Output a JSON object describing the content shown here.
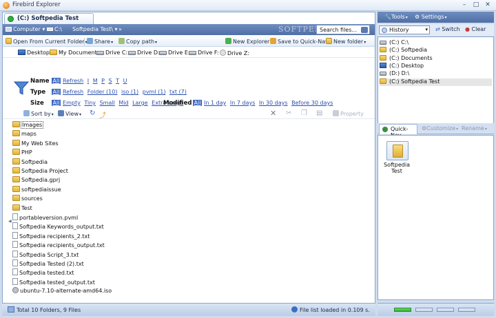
{
  "window": {
    "title": "Firebird Explorer"
  },
  "tab": {
    "label": "(C:) Softpedia Test"
  },
  "address": {
    "crumbs": [
      "Computer ▾",
      "C:\\",
      "Softpedia Test\\ ▾",
      "»"
    ],
    "watermark": "SOFTPEDIA",
    "search_placeholder": "Search files..."
  },
  "toolbar": {
    "open_from": "Open From Current Folder",
    "share": "Share",
    "copy_path": "Copy path",
    "new_explorer": "New Explorer",
    "save_quicknav": "Save to Quick-Nav",
    "new_folder": "New folder"
  },
  "places": [
    "Desktop",
    "My Documents",
    "Drive C:",
    "Drive D:",
    "Drive E:",
    "Drive F:",
    "Drive Z:"
  ],
  "filter": {
    "name_label": "Name",
    "name_all": "All",
    "name_opts": [
      "Refresh",
      "I",
      "M",
      "P",
      "S",
      "T",
      "U"
    ],
    "type_label": "Type",
    "type_all": "All",
    "type_opts": [
      "Refresh",
      "Folder (10)",
      "iso (1)",
      "pvml (1)",
      "txt (7)"
    ],
    "size_label": "Size",
    "size_all": "All",
    "size_opts": [
      "Empty",
      "Tiny",
      "Small",
      "Mid",
      "Large",
      "Extra Large"
    ],
    "modified_label": "Modified",
    "modified_all": "All",
    "modified_opts": [
      "In 1 day",
      "In 7 days",
      "In 30 days",
      "Before 30 days"
    ]
  },
  "sortbar": {
    "sort_by": "Sort by",
    "view": "View",
    "property": "Property"
  },
  "files": [
    {
      "name": "Images",
      "kind": "folder",
      "focused": true
    },
    {
      "name": "maps",
      "kind": "folder"
    },
    {
      "name": "My Web Sites",
      "kind": "folder"
    },
    {
      "name": "PHP",
      "kind": "folder"
    },
    {
      "name": "Softpedia",
      "kind": "folder"
    },
    {
      "name": "Softpedia Project",
      "kind": "folder"
    },
    {
      "name": "Softpedia.gprj",
      "kind": "folder"
    },
    {
      "name": "softpediaissue",
      "kind": "folder"
    },
    {
      "name": "sources",
      "kind": "folder"
    },
    {
      "name": "Test",
      "kind": "folder"
    },
    {
      "name": "portableversion.pvml",
      "kind": "file"
    },
    {
      "name": "Softpedia Keywords_output.txt",
      "kind": "file"
    },
    {
      "name": "Softpedia recipients_2.txt",
      "kind": "file"
    },
    {
      "name": "Softpedia recipients_output.txt",
      "kind": "file"
    },
    {
      "name": "Softpedia Script_3.txt",
      "kind": "file"
    },
    {
      "name": "Softpedia Tested (2).txt",
      "kind": "file"
    },
    {
      "name": "Softpedia tested.txt",
      "kind": "file"
    },
    {
      "name": "Softpedia tested_output.txt",
      "kind": "file"
    },
    {
      "name": "ubuntu-7.10-alternate-amd64.iso",
      "kind": "iso"
    }
  ],
  "status": {
    "total": "Total 10 Folders, 9 Files",
    "loaded": "File list loaded in 0.109 s."
  },
  "right": {
    "tools": "Tools",
    "settings": "Settings",
    "history_select": "History",
    "switch": "Switch",
    "clear": "Clear",
    "history": [
      {
        "label": "(C:)  C:\\",
        "icon": "drive"
      },
      {
        "label": "(C:)  Softpedia",
        "icon": "folder"
      },
      {
        "label": "(C:)  Documents",
        "icon": "folder"
      },
      {
        "label": "(C:)  Desktop",
        "icon": "desktop"
      },
      {
        "label": "(D:)  D:\\",
        "icon": "drive"
      },
      {
        "label": "(C:)  Softpedia Test",
        "icon": "folder",
        "selected": true
      }
    ],
    "quicknav_tab": "Quick-Nav",
    "customize": "Customize",
    "rename": "Rename",
    "quicknav_item": "Softpedia Test"
  }
}
